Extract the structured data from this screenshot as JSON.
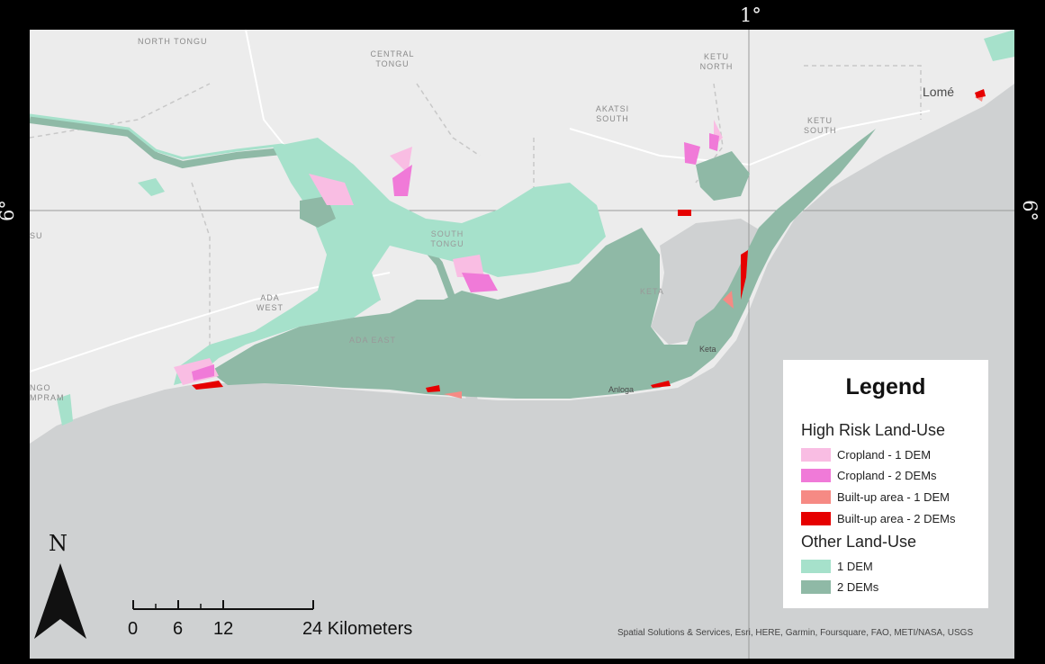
{
  "graticule": {
    "longitude_label": "1°",
    "latitude_label_left": "6°",
    "latitude_label_right": "6°"
  },
  "places": {
    "north_tongu": "NORTH TONGU",
    "central_tongu": "CENTRAL TONGU",
    "ketu_north": "KETU NORTH",
    "akatsi_south": "AKATSI SOUTH",
    "ketu_south": "KETU SOUTH",
    "ada_west": "ADA WEST",
    "south_tongu": "SOUTH TONGU",
    "keta_district": "KETA",
    "ada_east": "ADA EAST",
    "left_edge_1": "SU",
    "left_edge_2": "NGO\nMPRAM",
    "lome": "Lomé",
    "keta": "Keta",
    "anloga": "Anloga"
  },
  "legend": {
    "title": "Legend",
    "group1_title": "High Risk Land-Use",
    "group1_items": [
      {
        "label": "Cropland - 1 DEM",
        "color": "#f9bde3"
      },
      {
        "label": "Cropland - 2 DEMs",
        "color": "#f07ad8"
      },
      {
        "label": "Built-up area - 1 DEM",
        "color": "#f68a84"
      },
      {
        "label": "Built-up area - 2 DEMs",
        "color": "#e60000"
      }
    ],
    "group2_title": "Other Land-Use",
    "group2_items": [
      {
        "label": "1 DEM",
        "color": "#a6e1cb"
      },
      {
        "label": "2 DEMs",
        "color": "#8fb9a6"
      }
    ]
  },
  "scale_bar": {
    "ticks": [
      "0",
      "6",
      "12",
      "24 Kilometers"
    ]
  },
  "north_arrow": {
    "label": "N"
  },
  "attribution": "Spatial Solutions & Services, Esri, HERE, Garmin, Foursquare, FAO, METI/NASA, USGS",
  "colors": {
    "land": "#ececec",
    "sea": "#cfd1d2",
    "other_1dem": "#a6e1cb",
    "other_2dem": "#8fb9a6",
    "crop_1dem": "#f9bde3",
    "crop_2dem": "#f07ad8",
    "built_1dem": "#f68a84",
    "built_2dem": "#e60000"
  }
}
